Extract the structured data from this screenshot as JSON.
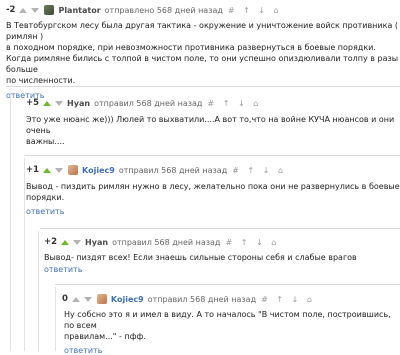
{
  "tool_icons": [
    "hash-icon",
    "up-arrow-icon",
    "down-arrow-icon",
    "share-icon"
  ],
  "comments": [
    {
      "score": "-2",
      "user": "Plantator",
      "meta": "отправлено 568 дней назад",
      "tools": "# ↑ ↓ ⌂",
      "lines": [
        "В Тевтобургском лесу была другая тактика - окружение и уничтожение войск противника ( римлян )",
        "в походном порядке, при невозможности противника развернуться в боевые порядки.",
        "Когда римляне бились с толпой в чистом поле, то они успешно опиздюливали толпу в разы больше",
        "по численности."
      ],
      "reply": "ответить"
    },
    {
      "score": "+5",
      "user": "Hyan",
      "meta": "отправил 568 дней назад",
      "tools": "# ↑ ↓ ⌂",
      "lines": [
        "Это уже нюанс же))) Люлей то выхватили....А вот то,что на войне КУЧА нюансов и они очень",
        "важны...."
      ],
      "reply": "ответить"
    },
    {
      "score": "+1",
      "user": "Kojiec9",
      "meta": "отправил 568 дней назад",
      "tools": "# ↑ ↓ ⌂",
      "lines": [
        "Вывод - пиздить римлян нужно в лесу, желательно пока они не развернулись в боевые",
        "порядки."
      ],
      "reply": "ответить"
    },
    {
      "score": "+2",
      "user": "Hyan",
      "meta": "отправил 568 дней назад",
      "tools": "# ↑ ↓ ⌂",
      "lines": [
        "Вывод- пиздят всех! Если знаешь сильные стороны себя и слабые врагов"
      ],
      "reply": "ответить"
    },
    {
      "score": "0",
      "user": "Kojiec9",
      "meta": "отправил 568 дней назад",
      "tools": "# ↑ ↓ ⌂",
      "lines": [
        "Ну собсно это я и имел в виду. А то началось \"В чистом поле, построившись, по всем",
        "правилам...\" - пфф."
      ],
      "reply": "ответить"
    }
  ]
}
